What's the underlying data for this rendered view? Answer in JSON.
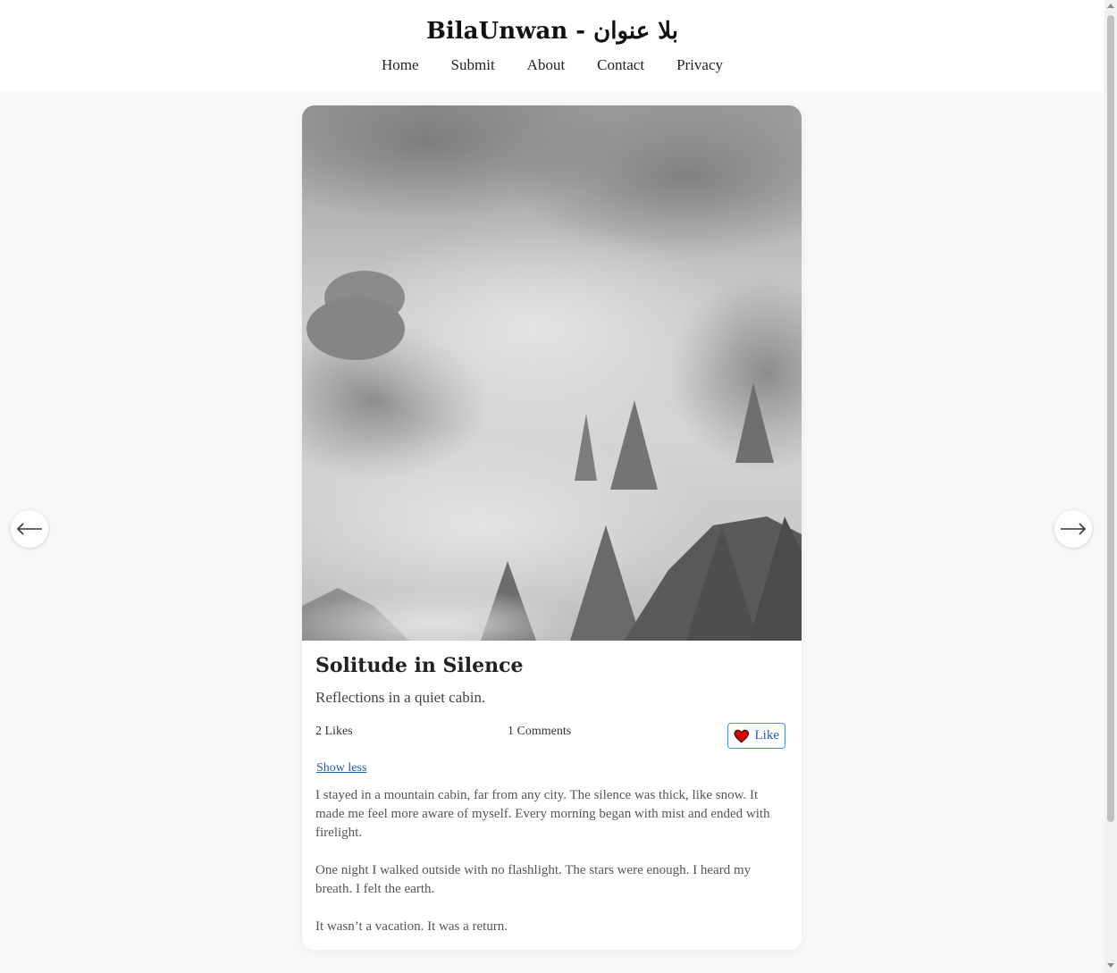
{
  "site": {
    "title": "BilaUnwan - بلا عنوان"
  },
  "nav": {
    "items": [
      "Home",
      "Submit",
      "About",
      "Contact",
      "Privacy"
    ]
  },
  "post": {
    "image_icon": "misty-forest-photo",
    "title": "Solitude in Silence",
    "subtitle": "Reflections in a quiet cabin.",
    "likes": "2 Likes",
    "comments": "1 Comments",
    "like_label": "Like",
    "toggle_label": "Show less",
    "paragraphs": [
      "I stayed in a mountain cabin, far from any city. The silence was thick, like snow. It made me feel more aware of myself. Every morning began with mist and ended with firelight.",
      "One night I walked outside with no flashlight. The stars were enough. I heard my breath. I felt the earth.",
      "It wasn’t a vacation. It was a return."
    ]
  },
  "colors": {
    "accent": "#1a5fb4",
    "heart": "#d90000",
    "page_bg": "#f7f8fa"
  },
  "icons": {
    "prev": "arrow-left-icon",
    "next": "arrow-right-icon",
    "like": "heart-icon"
  }
}
